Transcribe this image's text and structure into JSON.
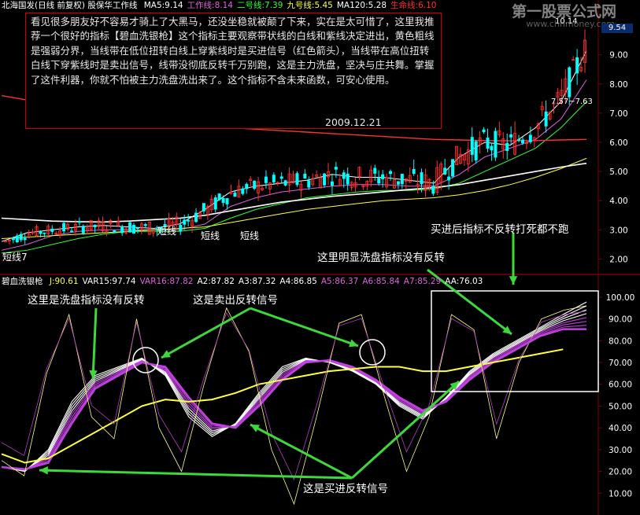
{
  "header": {
    "stock": "北海国发(日线 前复权) 股保华工作线",
    "items": [
      {
        "text": "MA5:9.14",
        "color": "#ffffff"
      },
      {
        "text": "工作线:8.14",
        "color": "#e060e0"
      },
      {
        "text": "二号线:7.39",
        "color": "#30ff30"
      },
      {
        "text": "九号线:5.45",
        "color": "#ffff40"
      },
      {
        "text": "MA120:5.28",
        "color": "#ffffff"
      },
      {
        "text": "生命线:6.10",
        "color": "#ff3030"
      }
    ]
  },
  "indicator_header": {
    "name": "碧血洗银枪",
    "items": [
      {
        "text": "J:90.61",
        "color": "#ffff40"
      },
      {
        "text": "VAR15:97.74",
        "color": "#ffffff"
      },
      {
        "text": "VAR16:87.82",
        "color": "#e060e0"
      },
      {
        "text": "A2:87.82",
        "color": "#ffffff"
      },
      {
        "text": "A3:87.32",
        "color": "#ffffff"
      },
      {
        "text": "A4:86.85",
        "color": "#ffffff"
      },
      {
        "text": "A5:86.37",
        "color": "#e060e0"
      },
      {
        "text": "A6:85.84",
        "color": "#e060e0"
      },
      {
        "text": "A7:85.29",
        "color": "#e060e0"
      },
      {
        "text": "AA:76.03",
        "color": "#ffffff"
      }
    ]
  },
  "watermark": {
    "title": "第一股票公式网",
    "url": "www.chnmoney.com"
  },
  "price_tag": "9.54",
  "note": {
    "text": "看见很多朋友好不容易才骑上了大黑马，还没坐稳就被颠了下来，实在是太可惜了，这里我推荐一个很好的指标【碧血洗银枪】这个指标主要观察带状线的白线和紫线决定进出，黄色粗线是强弱分界，当线带在低位扭转白线上穿紫线时是买进信号（红色箭头），当线带在高位扭转白线下穿紫线时是卖出信号，线带没彻底反转千万别跑，这是主力洗盘，坚决与庄共舞。掌握了这件利器，你就不怕被主力洗盘洗出来了。这个指标不含未来函数，可安心使用。",
    "date": "2009.12.21"
  },
  "callouts": {
    "washout_left": "这里是洗盘指标没有反转",
    "sell_signal": "这是卖出反转信号",
    "washout_right": "这里明显洗盘指标没有反转",
    "buy_hold": "买进后指标不反转打死都不跑",
    "buy_signal": "这是买进反转信号"
  },
  "price_labels": {
    "short_line": "短线",
    "range_label": "7.57~7.63",
    "top_label": "10.14",
    "left_label": "短线7"
  },
  "colors": {
    "background": "#000000",
    "grid": "#7a0000",
    "axis_text": "#ffffff",
    "up_candle": "#ff3030",
    "down_candle": "#00ffff",
    "callout_arrow": "#3cd83c"
  },
  "chart_data": [
    {
      "type": "candlestick",
      "title": "北海国发(日线 前复权)",
      "ylim": [
        1.5,
        10.5
      ],
      "yticks": [
        2.0,
        3.0,
        4.0,
        5.0,
        6.0,
        7.0,
        8.0,
        9.0
      ],
      "series": [
        {
          "name": "MA5",
          "values": [
            2.6,
            2.9,
            3.0,
            3.1,
            3.15,
            3.1,
            3.05,
            3.2,
            3.7,
            4.3,
            4.5,
            4.6,
            4.7,
            4.9,
            4.8,
            4.8,
            4.7,
            4.6,
            5.5,
            6.0,
            5.9,
            6.5,
            7.4,
            9.14
          ]
        },
        {
          "name": "工作线",
          "values": [
            2.3,
            2.5,
            2.8,
            2.95,
            3.0,
            3.0,
            3.0,
            3.0,
            3.2,
            3.8,
            4.1,
            4.3,
            4.4,
            4.5,
            4.55,
            4.55,
            4.5,
            4.5,
            4.9,
            5.5,
            5.8,
            6.1,
            6.8,
            8.14
          ]
        },
        {
          "name": "二号线",
          "values": [
            2.2,
            2.3,
            2.5,
            2.7,
            2.85,
            2.95,
            2.95,
            2.95,
            3.05,
            3.4,
            3.7,
            3.9,
            4.1,
            4.2,
            4.3,
            4.35,
            4.35,
            4.4,
            4.6,
            5.0,
            5.4,
            5.8,
            6.5,
            7.39
          ]
        },
        {
          "name": "九号线",
          "values": [
            2.7,
            2.75,
            2.8,
            2.85,
            2.9,
            2.95,
            3.0,
            3.05,
            3.1,
            3.25,
            3.4,
            3.55,
            3.7,
            3.8,
            3.9,
            4.0,
            4.05,
            4.1,
            4.2,
            4.35,
            4.55,
            4.8,
            5.1,
            5.45
          ]
        },
        {
          "name": "MA120",
          "values": [
            3.4,
            3.35,
            3.3,
            3.28,
            3.27,
            3.3,
            3.35,
            3.4,
            3.5,
            3.65,
            3.8,
            3.95,
            4.05,
            4.15,
            4.22,
            4.3,
            4.38,
            4.45,
            4.55,
            4.7,
            4.85,
            5.0,
            5.15,
            5.28
          ]
        },
        {
          "name": "生命线",
          "values": [
            7.6,
            7.45,
            7.3,
            7.15,
            7.0,
            6.9,
            6.8,
            6.7,
            6.6,
            6.5,
            6.45,
            6.4,
            6.35,
            6.3,
            6.25,
            6.2,
            6.15,
            6.1,
            6.08,
            6.06,
            6.05,
            6.06,
            6.08,
            6.1
          ]
        }
      ]
    },
    {
      "type": "line",
      "title": "碧血洗银枪",
      "ylim": [
        0,
        105
      ],
      "yticks": [
        10.0,
        20.0,
        30.0,
        40.0,
        50.0,
        60.0,
        70.0,
        80.0,
        90.0,
        100.0
      ],
      "series": [
        {
          "name": "J",
          "values": [
            25,
            18,
            65,
            92,
            45,
            35,
            90,
            40,
            20,
            60,
            95,
            75,
            30,
            5,
            45,
            88,
            92,
            55,
            20,
            45,
            92,
            85,
            35,
            70,
            90,
            94,
            96
          ]
        },
        {
          "name": "VAR15",
          "values": [
            22,
            20,
            30,
            52,
            64,
            68,
            72,
            64,
            45,
            36,
            42,
            56,
            68,
            72,
            70,
            66,
            60,
            50,
            44,
            54,
            66,
            74,
            80,
            86,
            92,
            97.74
          ]
        },
        {
          "name": "A7",
          "values": [
            22,
            21,
            24,
            42,
            58,
            64,
            70,
            68,
            54,
            42,
            40,
            50,
            62,
            70,
            71,
            68,
            62,
            54,
            48,
            52,
            62,
            70,
            76,
            82,
            85.29
          ]
        },
        {
          "name": "AA",
          "values": [
            28,
            24,
            26,
            32,
            38,
            44,
            50,
            53,
            52,
            53,
            56,
            60,
            62,
            64,
            66,
            67,
            68,
            68,
            66,
            66,
            68,
            70,
            72,
            74,
            76.03
          ]
        }
      ]
    }
  ]
}
